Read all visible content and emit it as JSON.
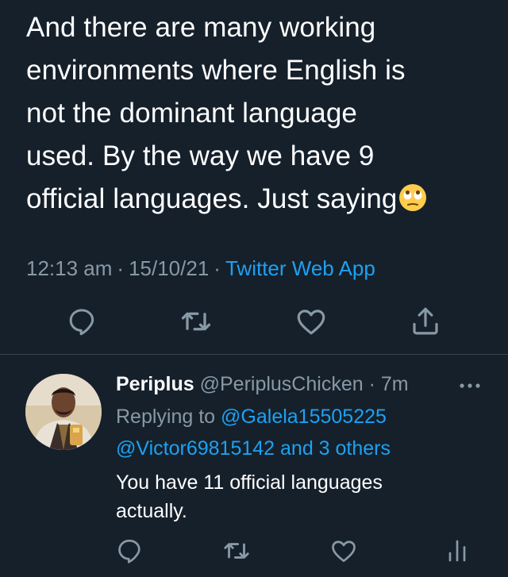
{
  "tweet": {
    "text_lines": [
      "And there are many working",
      "environments where English is",
      "not the dominant language",
      "used. By the way we have 9",
      "official languages. Just saying"
    ],
    "emoji": "face-with-rolling-eyes",
    "time": "12:13 am",
    "date": "15/10/21",
    "separator": "·",
    "source": "Twitter Web App"
  },
  "reply": {
    "display_name": "Periplus",
    "handle": "@PeriplusChicken",
    "age": "7m",
    "separator": "·",
    "replying_label": "Replying to",
    "mention_1": "@Galela15505225",
    "mention_2": "@Victor69815142",
    "and_others": "and 3 others",
    "text_line_1": "You have 11 official languages",
    "text_line_2": "actually."
  },
  "icons": {
    "reply": "reply-icon",
    "retweet": "retweet-icon",
    "like": "heart-icon",
    "share": "share-icon",
    "analytics": "analytics-icon",
    "more": "more-icon"
  },
  "colors": {
    "background": "#15202b",
    "text": "#ffffff",
    "secondary": "#8899a6",
    "link": "#1da1f2",
    "divider": "#38444d"
  }
}
